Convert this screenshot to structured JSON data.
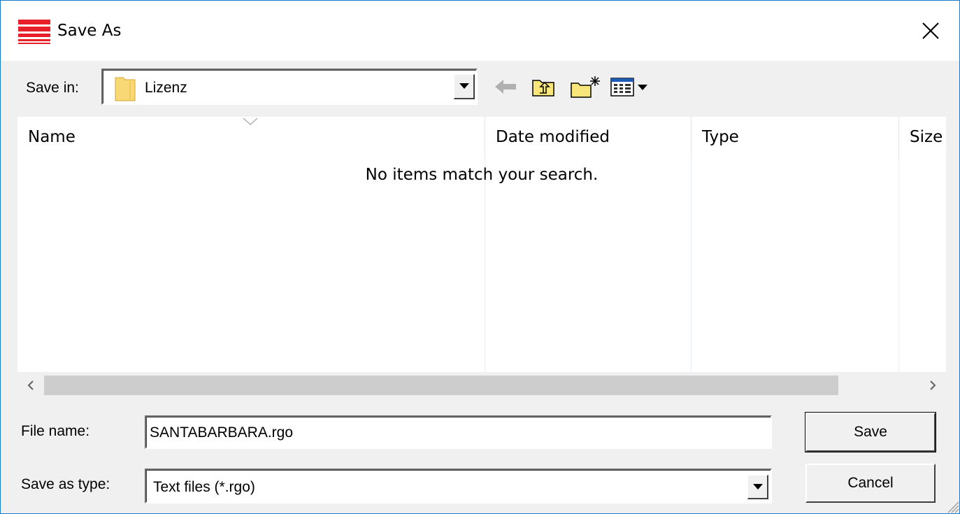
{
  "window": {
    "title": "Save As"
  },
  "toolbar": {
    "save_in_label": "Save in:",
    "current_folder": "Lizenz"
  },
  "file_list": {
    "columns": [
      "Name",
      "Date modified",
      "Type",
      "Size"
    ],
    "empty_message": "No items match your search."
  },
  "form": {
    "file_name_label": "File name:",
    "file_name_value": "SANTABARBARA.rgo",
    "save_as_type_label": "Save as type:",
    "save_as_type_value": "Text files (*.rgo)"
  },
  "buttons": {
    "save": "Save",
    "cancel": "Cancel"
  },
  "colors": {
    "app_icon": "#e8202a",
    "folder": "#f8d775",
    "window_border": "#1a79c9"
  },
  "icons": {
    "app": "red-stripes-icon",
    "close": "close-icon",
    "back": "back-arrow-icon",
    "up": "folder-up-icon",
    "new_folder": "new-folder-icon",
    "view_menu": "view-menu-icon"
  }
}
